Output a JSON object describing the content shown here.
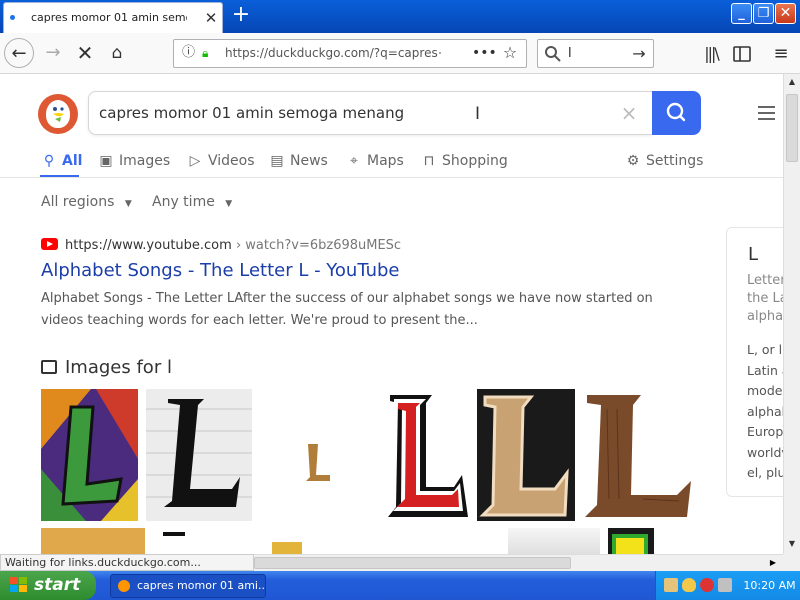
{
  "browser": {
    "tab_title": "capres momor 01 amin semoga menang",
    "tab_close": "✕",
    "new_tab": "+",
    "url": "https://duckduckgo.com/?q=capres+",
    "search_box_value": "l",
    "window_buttons": {
      "minimize": "_",
      "maximize": "❐",
      "close": "✕"
    }
  },
  "ddg": {
    "query": "capres momor 01 amin semoga menang",
    "tabs": [
      {
        "label": "All",
        "icon": "search-icon",
        "active": true
      },
      {
        "label": "Images",
        "icon": "image-icon"
      },
      {
        "label": "Videos",
        "icon": "play-icon"
      },
      {
        "label": "News",
        "icon": "newspaper-icon"
      },
      {
        "label": "Maps",
        "icon": "map-pin-icon"
      },
      {
        "label": "Shopping",
        "icon": "shopping-bag-icon"
      }
    ],
    "settings_label": "Settings",
    "filters": {
      "regions": "All regions",
      "time": "Any time"
    },
    "result": {
      "source_domain": "https://www.youtube.com",
      "source_path": "› watch?v=6bz698uMESc",
      "title": "Alphabet Songs - The Letter L - YouTube",
      "snippet": "Alphabet Songs - The Letter LAfter the success of our alphabet songs we have now started on videos teaching words for each letter. We're proud to present the..."
    },
    "images_header": "Images for l",
    "knowledge_panel": {
      "title": "L",
      "subtitle": "Letter the La alpha",
      "body": "L, or l, Latin a mode alphab Europ worldv el, plu"
    }
  },
  "status_text": "Waiting for links.duckduckgo.com...",
  "taskbar": {
    "start_label": "start",
    "task_label": "capres momor 01 ami...",
    "clock": "10:20 AM"
  },
  "colors": {
    "ddg_blue": "#3969ef",
    "link": "#1b3ea8",
    "ddg_orange": "#de5833",
    "xp_blue": "#245edb"
  }
}
